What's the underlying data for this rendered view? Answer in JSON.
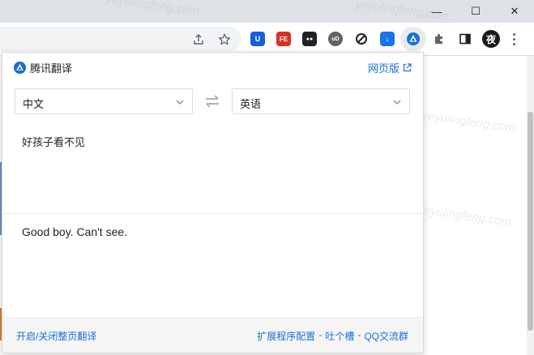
{
  "browser": {
    "window_controls": [
      "—",
      "☐",
      "✕"
    ]
  },
  "extensions": [
    {
      "name": "bitwarden",
      "glyph": "U",
      "color": "#175ddc"
    },
    {
      "name": "fe-helper",
      "glyph": "FE",
      "color": "#d93025"
    },
    {
      "name": "tabs",
      "glyph": "●●",
      "color": "#202124"
    },
    {
      "name": "ublock",
      "glyph": "uD",
      "color": "#5f6368"
    },
    {
      "name": "block",
      "glyph": "⊘",
      "color": "#202124"
    },
    {
      "name": "download",
      "glyph": "↓",
      "color": "#1a73e8"
    },
    {
      "name": "tencent-translate",
      "glyph": "▲",
      "color": "#1a6fd8"
    }
  ],
  "avatar": {
    "text": "夜"
  },
  "popup": {
    "app_title": "腾讯翻译",
    "web_version_link": "网页版",
    "source_lang": "中文",
    "target_lang": "英语",
    "source_text": "好孩子看不见",
    "result_text": "Good boy. Can't see.",
    "footer": {
      "toggle_page_translate": "开启/关闭整页翻译",
      "extension_settings": "扩展程序配置",
      "feedback": "吐个槽",
      "qq_group": "QQ交流群",
      "separator": "-"
    }
  },
  "watermark": "yeyulingfeng.com"
}
